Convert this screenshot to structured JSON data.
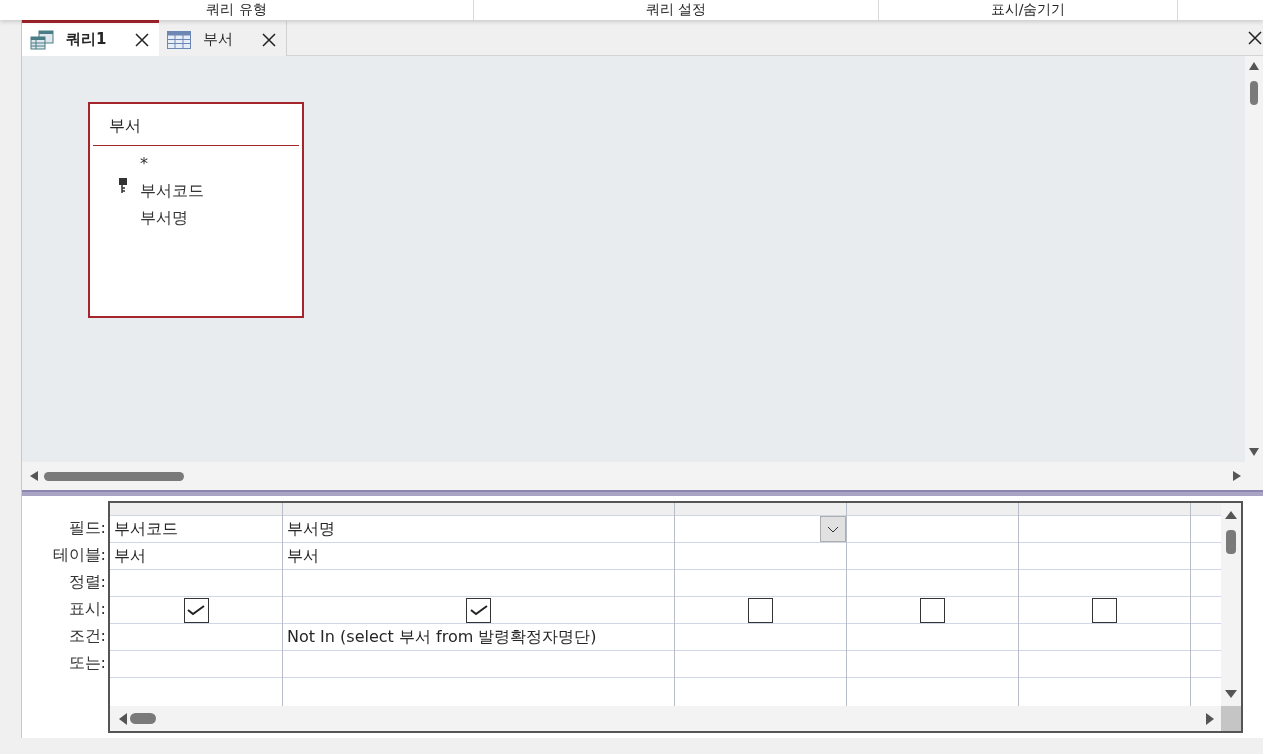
{
  "ribbon_groups": [
    {
      "label": "쿼리 유형"
    },
    {
      "label": "쿼리 설정"
    },
    {
      "label": "표시/숨기기"
    }
  ],
  "tabs": [
    {
      "label": "쿼리1",
      "selected": true,
      "kind": "query"
    },
    {
      "label": "부서",
      "selected": false,
      "kind": "table"
    }
  ],
  "table_box": {
    "title": "부서",
    "fields": [
      {
        "name": "*",
        "primary_key": false
      },
      {
        "name": "부서코드",
        "primary_key": true
      },
      {
        "name": "부서명",
        "primary_key": false
      }
    ]
  },
  "grid": {
    "row_labels": [
      "필드:",
      "테이블:",
      "정렬:",
      "표시:",
      "조건:",
      "또는:"
    ],
    "columns": [
      {
        "field": "부서코드",
        "table": "부서",
        "show": true,
        "active": false
      },
      {
        "field": "부서명",
        "table": "부서",
        "show": true,
        "criteria": "Not In (select 부서 from 발령확정자명단)",
        "active": false
      },
      {
        "show": false,
        "active": true
      },
      {
        "show": false,
        "active": false
      },
      {
        "show": false,
        "active": false
      }
    ]
  }
}
